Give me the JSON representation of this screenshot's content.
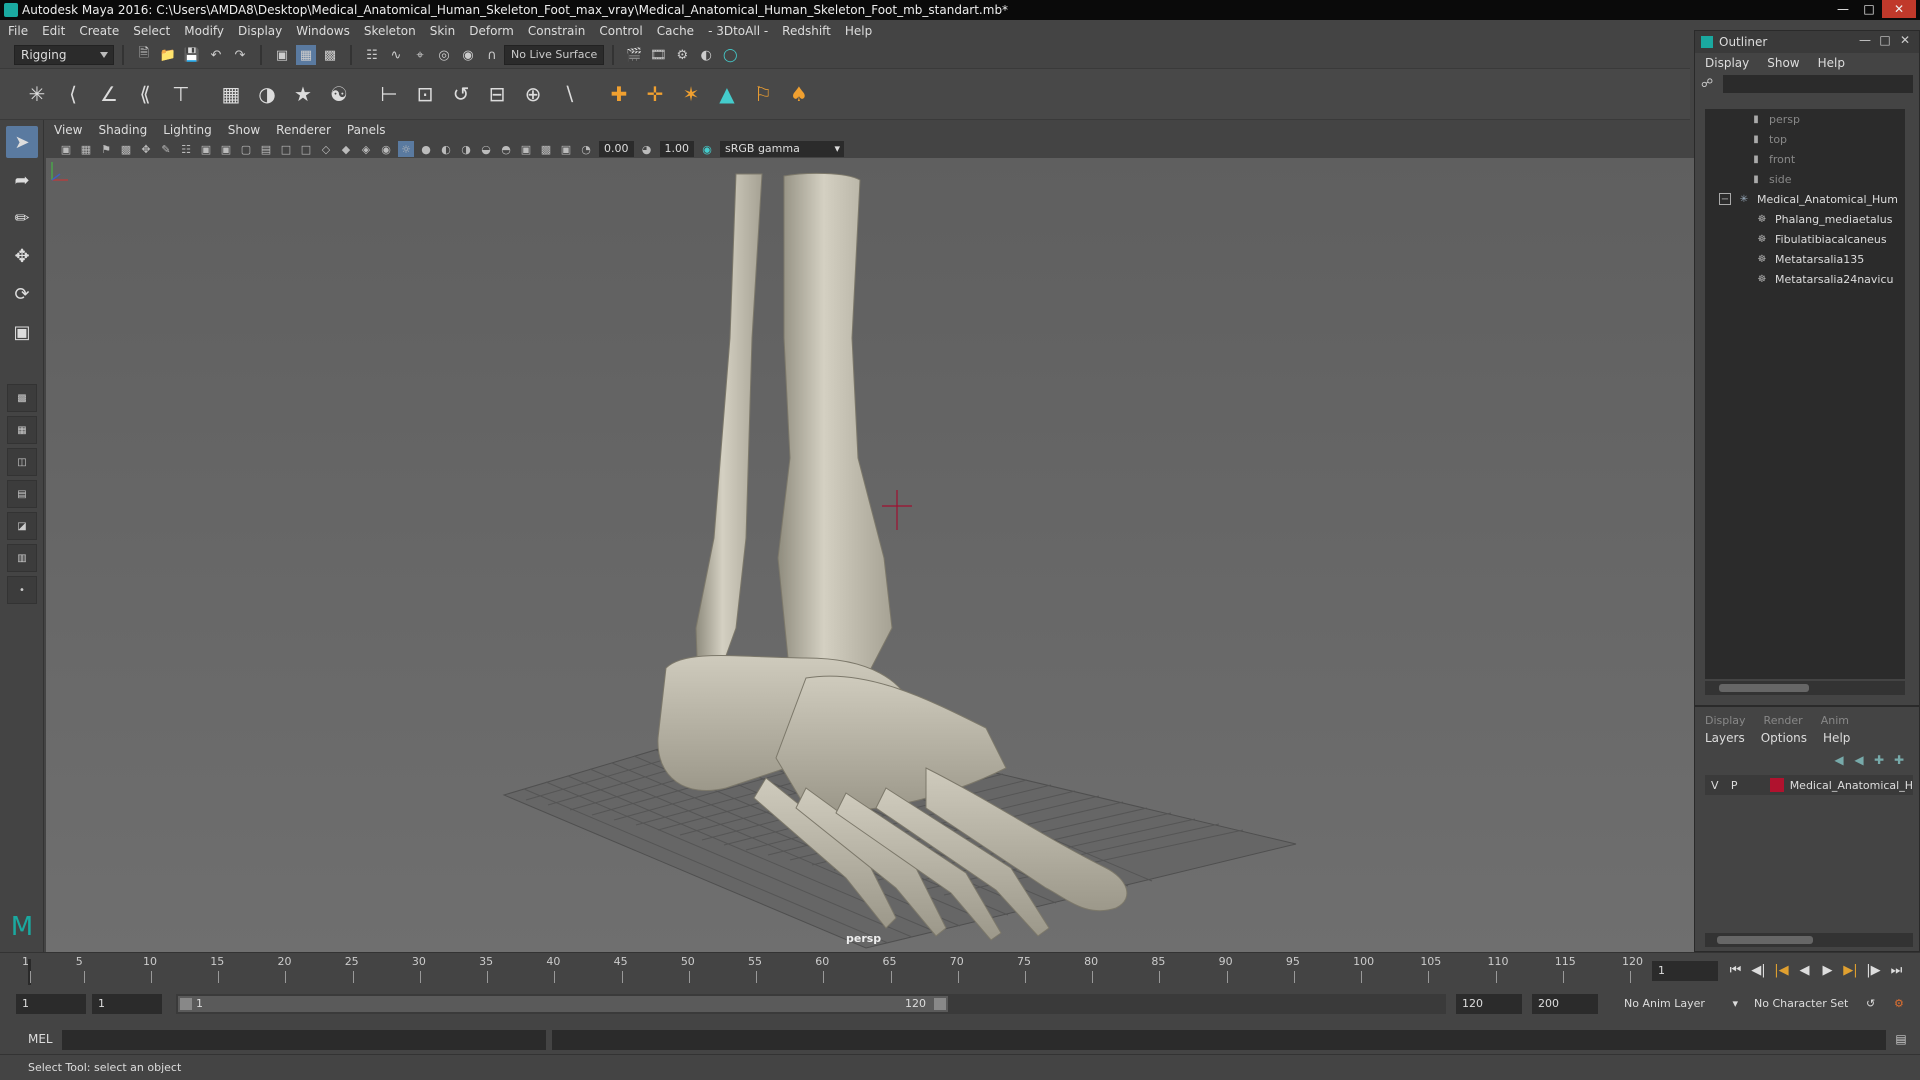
{
  "window": {
    "title": "Autodesk Maya 2016: C:\\Users\\AMDA8\\Desktop\\Medical_Anatomical_Human_Skeleton_Foot_max_vray\\Medical_Anatomical_Human_Skeleton_Foot_mb_standart.mb*"
  },
  "menubar": [
    "File",
    "Edit",
    "Create",
    "Select",
    "Modify",
    "Display",
    "Windows",
    "Skeleton",
    "Skin",
    "Deform",
    "Constrain",
    "Control",
    "Cache",
    "- 3DtoAll -",
    "Redshift",
    "Help"
  ],
  "statusline": {
    "mode": "Rigging",
    "live_surface": "No Live Surface"
  },
  "panel": {
    "menu": [
      "View",
      "Shading",
      "Lighting",
      "Show",
      "Renderer",
      "Panels"
    ],
    "exposure": "0.00",
    "gamma": "1.00",
    "color_space": "sRGB gamma",
    "camera_label": "persp"
  },
  "outliner": {
    "title": "Outliner",
    "menu": [
      "Display",
      "Show",
      "Help"
    ],
    "items": [
      {
        "name": "persp",
        "kind": "camera"
      },
      {
        "name": "top",
        "kind": "camera"
      },
      {
        "name": "front",
        "kind": "camera"
      },
      {
        "name": "side",
        "kind": "camera"
      },
      {
        "name": "Medical_Anatomical_Hum",
        "kind": "group"
      },
      {
        "name": "Phalang_mediaetalus",
        "kind": "mesh"
      },
      {
        "name": "Fibulatibiacalcaneus",
        "kind": "mesh"
      },
      {
        "name": "Metatarsalia135",
        "kind": "mesh"
      },
      {
        "name": "Metatarsalia24navicu",
        "kind": "mesh"
      }
    ]
  },
  "layers": {
    "tabs": [
      "Display",
      "Render",
      "Anim"
    ],
    "menu": [
      "Layers",
      "Options",
      "Help"
    ],
    "row": {
      "v": "V",
      "p": "P",
      "name": "Medical_Anatomical_H",
      "color": "#b0122e"
    }
  },
  "timeline": {
    "ticks": [
      1,
      5,
      10,
      15,
      20,
      25,
      30,
      35,
      40,
      45,
      50,
      55,
      60,
      65,
      70,
      75,
      80,
      85,
      90,
      95,
      100,
      105,
      110,
      115,
      120
    ],
    "current_frame": "1"
  },
  "range": {
    "start_field": "1",
    "start_anim": "1",
    "range_start": "1",
    "range_end": "120",
    "end_field": "120",
    "end_anim": "200",
    "anim_layer": "No Anim Layer",
    "character_set": "No Character Set"
  },
  "command": {
    "label": "MEL"
  },
  "helpline": {
    "text": "Select Tool: select an object"
  }
}
